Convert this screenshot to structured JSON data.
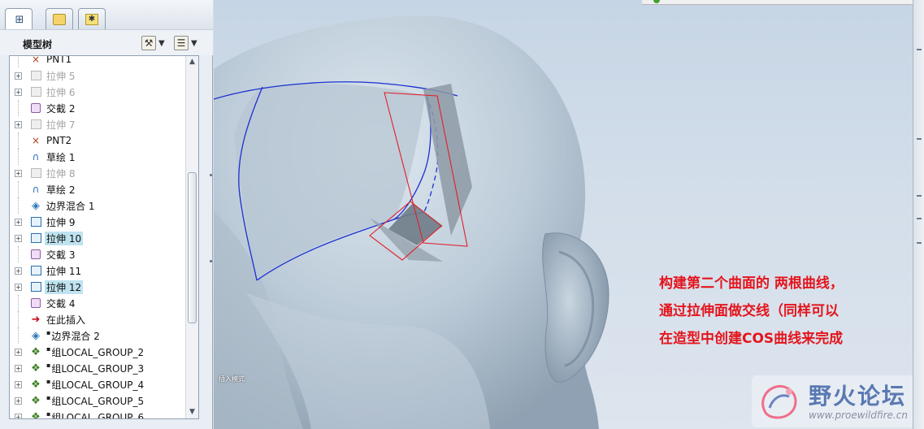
{
  "tabs": [
    {
      "name": "model-tree",
      "icon": "model-tree-icon"
    },
    {
      "name": "layers",
      "icon": "layers-icon"
    },
    {
      "name": "favorites",
      "icon": "favorites-icon"
    }
  ],
  "tree": {
    "title": "模型树",
    "settings_icon": "settings-icon",
    "show_icon": "show-icon",
    "items": [
      {
        "label": "PNT1",
        "icon": "datum-point-icon",
        "expandable": false,
        "state": "normal"
      },
      {
        "label": "拉伸 5",
        "icon": "extrude-icon",
        "expandable": true,
        "state": "suppressed"
      },
      {
        "label": "拉伸 6",
        "icon": "extrude-icon",
        "expandable": true,
        "state": "suppressed"
      },
      {
        "label": "交截 2",
        "icon": "intersect-icon",
        "expandable": false,
        "state": "normal"
      },
      {
        "label": "拉伸 7",
        "icon": "extrude-icon",
        "expandable": true,
        "state": "suppressed"
      },
      {
        "label": "PNT2",
        "icon": "datum-point-icon",
        "expandable": false,
        "state": "normal"
      },
      {
        "label": "草绘 1",
        "icon": "sketch-icon",
        "expandable": false,
        "state": "normal"
      },
      {
        "label": "拉伸 8",
        "icon": "extrude-icon",
        "expandable": true,
        "state": "suppressed"
      },
      {
        "label": "草绘 2",
        "icon": "sketch-icon",
        "expandable": false,
        "state": "normal"
      },
      {
        "label": "边界混合 1",
        "icon": "boundary-blend-icon",
        "expandable": false,
        "state": "normal"
      },
      {
        "label": "拉伸 9",
        "icon": "extrude-icon",
        "expandable": true,
        "state": "normal"
      },
      {
        "label": "拉伸 10",
        "icon": "extrude-icon",
        "expandable": true,
        "state": "highlighted"
      },
      {
        "label": "交截 3",
        "icon": "intersect-icon",
        "expandable": false,
        "state": "normal"
      },
      {
        "label": "拉伸 11",
        "icon": "extrude-icon",
        "expandable": true,
        "state": "normal"
      },
      {
        "label": "拉伸 12",
        "icon": "extrude-icon",
        "expandable": true,
        "state": "highlighted"
      },
      {
        "label": "交截 4",
        "icon": "intersect-icon",
        "expandable": false,
        "state": "normal"
      },
      {
        "label": "在此插入",
        "icon": "insert-here-arrow-icon",
        "expandable": false,
        "state": "normal"
      },
      {
        "label": "边界混合 2",
        "icon": "boundary-blend-icon",
        "expandable": false,
        "state": "normal",
        "marker": "▪"
      },
      {
        "label": "组LOCAL_GROUP_2",
        "icon": "group-icon",
        "expandable": true,
        "state": "normal",
        "marker": "▪"
      },
      {
        "label": "组LOCAL_GROUP_3",
        "icon": "group-icon",
        "expandable": true,
        "state": "normal",
        "marker": "▪"
      },
      {
        "label": "组LOCAL_GROUP_4",
        "icon": "group-icon",
        "expandable": true,
        "state": "normal",
        "marker": "▪"
      },
      {
        "label": "组LOCAL_GROUP_5",
        "icon": "group-icon",
        "expandable": true,
        "state": "normal",
        "marker": "▪"
      },
      {
        "label": "组LOCAL_GROUP_6",
        "icon": "group-icon",
        "expandable": true,
        "state": "normal",
        "marker": "▪"
      }
    ]
  },
  "scrollbar": {
    "position": 0.55
  },
  "viewport": {
    "annotation_lines": [
      "构建第二个曲面的 两根曲线，",
      "通过拉伸面做交线（同样可以",
      "在造型中创建COS曲线来完成"
    ],
    "annotation_color": "#e4141c",
    "small_label": "插入模式",
    "model_color": "#b9c9d6",
    "curve_color": "#1b2fd0",
    "extrude_outline_color": "#e0202a"
  },
  "watermark": {
    "name": "野火论坛",
    "url": "www.proewildfire.cn"
  }
}
